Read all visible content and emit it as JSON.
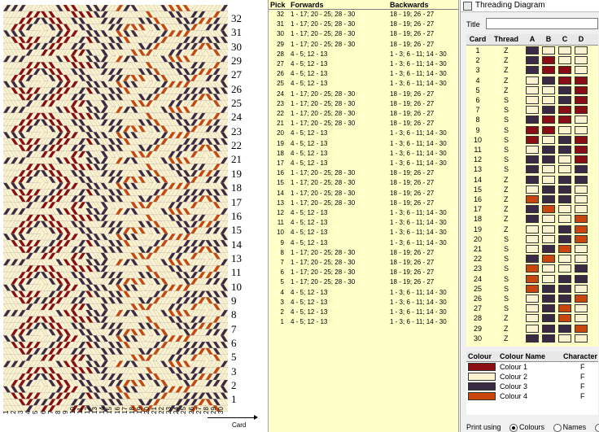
{
  "colors": {
    "colour1": "#8b0d14",
    "colour2": "#fbf2d0",
    "colour3": "#3b2a44",
    "colour4": "#c8460c"
  },
  "pattern": {
    "pick_numbers": [
      "32",
      "31",
      "30",
      "29",
      "27",
      "26",
      "25",
      "24",
      "23",
      "22",
      "21",
      "19",
      "18",
      "17",
      "16",
      "15",
      "14",
      "13",
      "11",
      "10",
      "9",
      "8",
      "7",
      "6",
      "5",
      "3",
      "2",
      "1"
    ],
    "card_numbers": [
      "1",
      "2",
      "3",
      "4",
      "5",
      "6",
      "7",
      "8",
      "9",
      "10",
      "11",
      "12",
      "13",
      "14",
      "15",
      "16",
      "17",
      "18",
      "19",
      "20",
      "21",
      "22",
      "23",
      "24",
      "25",
      "26",
      "27",
      "28",
      "29",
      "30"
    ],
    "card_label": "Card"
  },
  "sequence": {
    "headers": {
      "pick": "Pick",
      "forwards": "Forwards",
      "backwards": "Backwards"
    },
    "rows": [
      {
        "pick": "32",
        "forwards": "1 - 17; 20 - 25; 28 - 30",
        "backwards": "18 - 19; 26 - 27"
      },
      {
        "pick": "31",
        "forwards": "1 - 17; 20 - 25; 28 - 30",
        "backwards": "18 - 19; 26 - 27"
      },
      {
        "pick": "30",
        "forwards": "1 - 17; 20 - 25; 28 - 30",
        "backwards": "18 - 19; 26 - 27"
      },
      {
        "pick": "29",
        "forwards": "1 - 17; 20 - 25; 28 - 30",
        "backwards": "18 - 19; 26 - 27"
      },
      {
        "pick": "28",
        "forwards": "4 - 5; 12 - 13",
        "backwards": "1 - 3; 6 - 11; 14 - 30"
      },
      {
        "pick": "27",
        "forwards": "4 - 5; 12 - 13",
        "backwards": "1 - 3; 6 - 11; 14 - 30"
      },
      {
        "pick": "26",
        "forwards": "4 - 5; 12 - 13",
        "backwards": "1 - 3; 6 - 11; 14 - 30"
      },
      {
        "pick": "25",
        "forwards": "4 - 5; 12 - 13",
        "backwards": "1 - 3; 6 - 11; 14 - 30"
      },
      {
        "pick": "24",
        "forwards": "1 - 17; 20 - 25; 28 - 30",
        "backwards": "18 - 19; 26 - 27"
      },
      {
        "pick": "23",
        "forwards": "1 - 17; 20 - 25; 28 - 30",
        "backwards": "18 - 19; 26 - 27"
      },
      {
        "pick": "22",
        "forwards": "1 - 17; 20 - 25; 28 - 30",
        "backwards": "18 - 19; 26 - 27"
      },
      {
        "pick": "21",
        "forwards": "1 - 17; 20 - 25; 28 - 30",
        "backwards": "18 - 19; 26 - 27"
      },
      {
        "pick": "20",
        "forwards": "4 - 5; 12 - 13",
        "backwards": "1 - 3; 6 - 11; 14 - 30"
      },
      {
        "pick": "19",
        "forwards": "4 - 5; 12 - 13",
        "backwards": "1 - 3; 6 - 11; 14 - 30"
      },
      {
        "pick": "18",
        "forwards": "4 - 5; 12 - 13",
        "backwards": "1 - 3; 6 - 11; 14 - 30"
      },
      {
        "pick": "17",
        "forwards": "4 - 5; 12 - 13",
        "backwards": "1 - 3; 6 - 11; 14 - 30"
      },
      {
        "pick": "16",
        "forwards": "1 - 17; 20 - 25; 28 - 30",
        "backwards": "18 - 19; 26 - 27"
      },
      {
        "pick": "15",
        "forwards": "1 - 17; 20 - 25; 28 - 30",
        "backwards": "18 - 19; 26 - 27"
      },
      {
        "pick": "14",
        "forwards": "1 - 17; 20 - 25; 28 - 30",
        "backwards": "18 - 19; 26 - 27"
      },
      {
        "pick": "13",
        "forwards": "1 - 17; 20 - 25; 28 - 30",
        "backwards": "18 - 19; 26 - 27"
      },
      {
        "pick": "12",
        "forwards": "4 - 5; 12 - 13",
        "backwards": "1 - 3; 6 - 11; 14 - 30"
      },
      {
        "pick": "11",
        "forwards": "4 - 5; 12 - 13",
        "backwards": "1 - 3; 6 - 11; 14 - 30"
      },
      {
        "pick": "10",
        "forwards": "4 - 5; 12 - 13",
        "backwards": "1 - 3; 6 - 11; 14 - 30"
      },
      {
        "pick": "9",
        "forwards": "4 - 5; 12 - 13",
        "backwards": "1 - 3; 6 - 11; 14 - 30"
      },
      {
        "pick": "8",
        "forwards": "1 - 17; 20 - 25; 28 - 30",
        "backwards": "18 - 19; 26 - 27"
      },
      {
        "pick": "7",
        "forwards": "1 - 17; 20 - 25; 28 - 30",
        "backwards": "18 - 19; 26 - 27"
      },
      {
        "pick": "6",
        "forwards": "1 - 17; 20 - 25; 28 - 30",
        "backwards": "18 - 19; 26 - 27"
      },
      {
        "pick": "5",
        "forwards": "1 - 17; 20 - 25; 28 - 30",
        "backwards": "18 - 19; 26 - 27"
      },
      {
        "pick": "4",
        "forwards": "4 - 5; 12 - 13",
        "backwards": "1 - 3; 6 - 11; 14 - 30"
      },
      {
        "pick": "3",
        "forwards": "4 - 5; 12 - 13",
        "backwards": "1 - 3; 6 - 11; 14 - 30"
      },
      {
        "pick": "2",
        "forwards": "4 - 5; 12 - 13",
        "backwards": "1 - 3; 6 - 11; 14 - 30"
      },
      {
        "pick": "1",
        "forwards": "4 - 5; 12 - 13",
        "backwards": "1 - 3; 6 - 11; 14 - 30"
      }
    ]
  },
  "threading": {
    "window_title": "Threading Diagram",
    "title_label": "Title",
    "title_value": "",
    "headers": {
      "card": "Card",
      "thread": "Thread",
      "a": "A",
      "b": "B",
      "c": "C",
      "d": "D"
    },
    "rows": [
      {
        "card": "1",
        "thread": "Z",
        "holes": [
          3,
          2,
          2,
          2
        ]
      },
      {
        "card": "2",
        "thread": "Z",
        "holes": [
          3,
          1,
          2,
          2
        ]
      },
      {
        "card": "3",
        "thread": "Z",
        "holes": [
          3,
          1,
          1,
          2
        ]
      },
      {
        "card": "4",
        "thread": "Z",
        "holes": [
          2,
          3,
          1,
          1
        ]
      },
      {
        "card": "5",
        "thread": "Z",
        "holes": [
          2,
          2,
          3,
          1
        ]
      },
      {
        "card": "6",
        "thread": "S",
        "holes": [
          2,
          2,
          3,
          1
        ]
      },
      {
        "card": "7",
        "thread": "S",
        "holes": [
          2,
          3,
          1,
          1
        ]
      },
      {
        "card": "8",
        "thread": "S",
        "holes": [
          3,
          1,
          1,
          2
        ]
      },
      {
        "card": "9",
        "thread": "S",
        "holes": [
          1,
          1,
          2,
          2
        ]
      },
      {
        "card": "10",
        "thread": "S",
        "holes": [
          1,
          2,
          3,
          1
        ]
      },
      {
        "card": "11",
        "thread": "S",
        "holes": [
          2,
          3,
          3,
          1
        ]
      },
      {
        "card": "12",
        "thread": "S",
        "holes": [
          3,
          3,
          2,
          1
        ]
      },
      {
        "card": "13",
        "thread": "S",
        "holes": [
          3,
          2,
          2,
          3
        ]
      },
      {
        "card": "14",
        "thread": "Z",
        "holes": [
          3,
          2,
          3,
          3
        ]
      },
      {
        "card": "15",
        "thread": "Z",
        "holes": [
          2,
          3,
          3,
          2
        ]
      },
      {
        "card": "16",
        "thread": "Z",
        "holes": [
          4,
          3,
          3,
          2
        ]
      },
      {
        "card": "17",
        "thread": "Z",
        "holes": [
          3,
          4,
          2,
          2
        ]
      },
      {
        "card": "18",
        "thread": "Z",
        "holes": [
          3,
          2,
          2,
          4
        ]
      },
      {
        "card": "19",
        "thread": "Z",
        "holes": [
          2,
          2,
          3,
          4
        ]
      },
      {
        "card": "20",
        "thread": "S",
        "holes": [
          2,
          2,
          3,
          4
        ]
      },
      {
        "card": "21",
        "thread": "S",
        "holes": [
          2,
          3,
          4,
          2
        ]
      },
      {
        "card": "22",
        "thread": "S",
        "holes": [
          3,
          4,
          2,
          2
        ]
      },
      {
        "card": "23",
        "thread": "S",
        "holes": [
          4,
          2,
          2,
          3
        ]
      },
      {
        "card": "24",
        "thread": "S",
        "holes": [
          4,
          2,
          3,
          3
        ]
      },
      {
        "card": "25",
        "thread": "S",
        "holes": [
          4,
          3,
          3,
          2
        ]
      },
      {
        "card": "26",
        "thread": "S",
        "holes": [
          2,
          3,
          3,
          4
        ]
      },
      {
        "card": "27",
        "thread": "S",
        "holes": [
          2,
          3,
          4,
          2
        ]
      },
      {
        "card": "28",
        "thread": "Z",
        "holes": [
          2,
          3,
          4,
          2
        ]
      },
      {
        "card": "29",
        "thread": "Z",
        "holes": [
          2,
          3,
          3,
          4
        ]
      },
      {
        "card": "30",
        "thread": "Z",
        "holes": [
          3,
          3,
          2,
          2
        ]
      }
    ]
  },
  "colour_table": {
    "headers": {
      "colour": "Colour",
      "name": "Colour Name",
      "character": "Character"
    },
    "rows": [
      {
        "name": "Colour 1",
        "character": "F",
        "color": "#8b0d14"
      },
      {
        "name": "Colour 2",
        "character": "F",
        "color": "#fbf2d0"
      },
      {
        "name": "Colour 3",
        "character": "F",
        "color": "#3b2a44"
      },
      {
        "name": "Colour 4",
        "character": "F",
        "color": "#c8460c"
      }
    ]
  },
  "print": {
    "label": "Print using",
    "options": [
      "Colours",
      "Names",
      "C"
    ],
    "selected": "Colours"
  }
}
